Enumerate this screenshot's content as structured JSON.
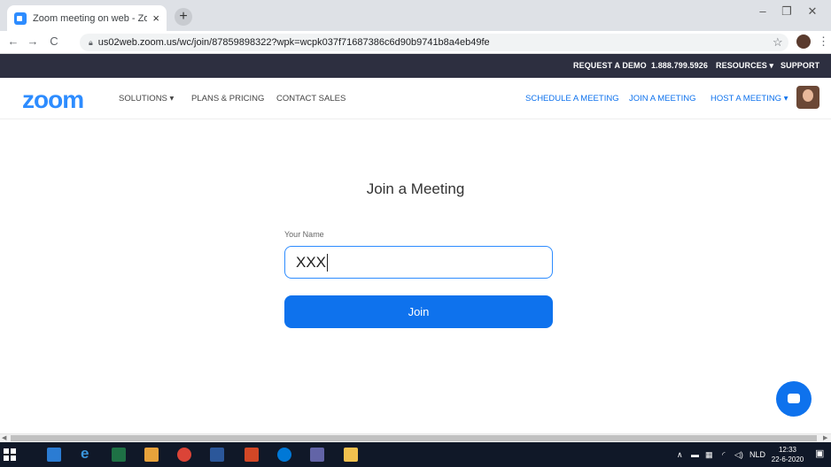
{
  "browser": {
    "tab_title": "Zoom meeting on web - Zoom",
    "tab_close": "×",
    "new_tab": "+",
    "url": "us02web.zoom.us/wc/join/87859898322?wpk=wcpk037f71687386c6d90b9741b8a4eb49fe"
  },
  "topbar": {
    "request_demo": "REQUEST A DEMO",
    "phone": "1.888.799.5926",
    "resources": "RESOURCES ▾",
    "support": "SUPPORT"
  },
  "nav": {
    "logo": "zoom",
    "solutions": "SOLUTIONS ▾",
    "plans": "PLANS & PRICING",
    "contact": "CONTACT SALES",
    "schedule": "SCHEDULE A MEETING",
    "join": "JOIN A MEETING",
    "host": "HOST A MEETING ▾"
  },
  "join_form": {
    "title": "Join a Meeting",
    "name_label": "Your Name",
    "name_value": "XXX",
    "button_label": "Join"
  },
  "taskbar": {
    "language": "NLD",
    "time": "12:33",
    "date": "22-6-2020"
  },
  "colors": {
    "accent": "#0e72ed",
    "logo_blue": "#2d8cff",
    "topbar": "#2d2f40",
    "taskbar": "#101828"
  }
}
